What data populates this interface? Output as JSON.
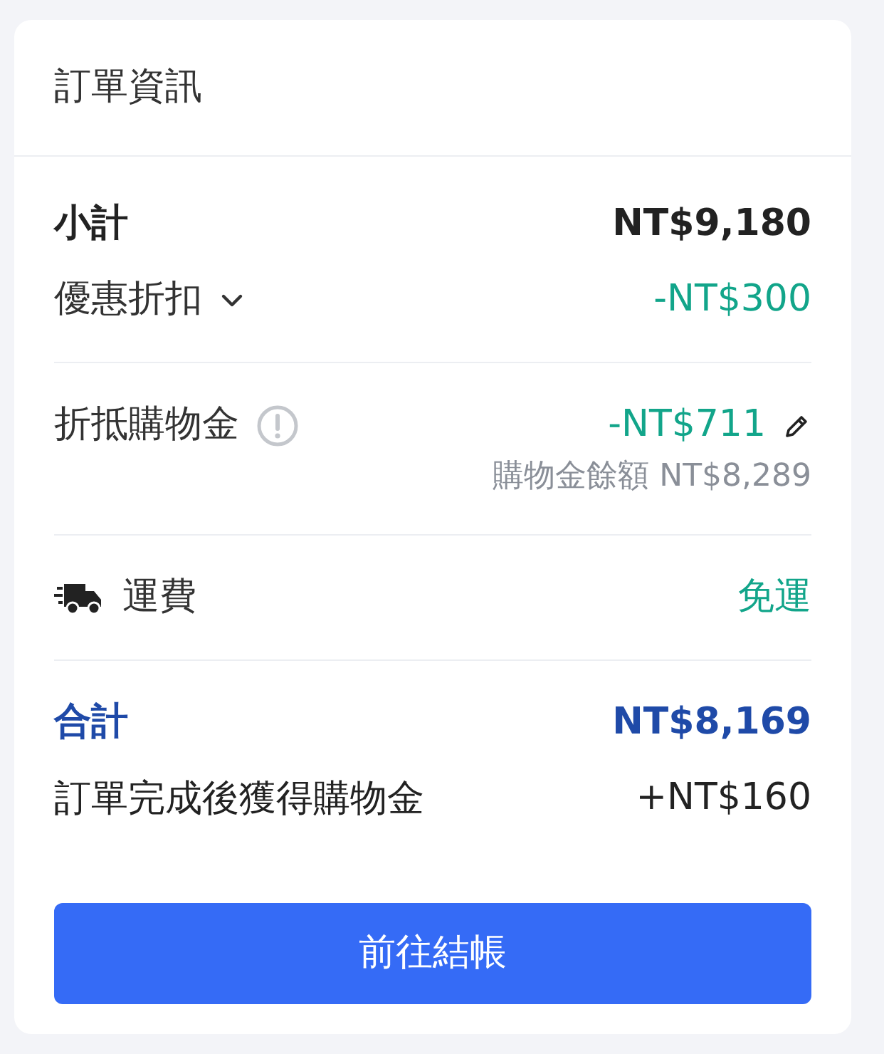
{
  "title": "訂單資訊",
  "sections": [
    {
      "rows": [
        {
          "kind": "subtotal",
          "label": "小計",
          "value": "NT$9,180"
        },
        {
          "kind": "discount",
          "label": "優惠折扣",
          "value": "-NT$300",
          "expanded": false
        }
      ]
    },
    {
      "rows": [
        {
          "kind": "credit",
          "label": "折抵購物金",
          "value": "-NT$711",
          "note": "購物金餘額 NT$8,289"
        }
      ]
    },
    {
      "rows": [
        {
          "kind": "shipping",
          "label": "運費",
          "value": "免運"
        }
      ]
    },
    {
      "rows": [
        {
          "kind": "total",
          "label": "合計",
          "value": "NT$8,169"
        },
        {
          "kind": "earn",
          "label": "訂單完成後獲得購物金",
          "value": "+NT$160"
        }
      ]
    }
  ],
  "button": "前往結帳"
}
